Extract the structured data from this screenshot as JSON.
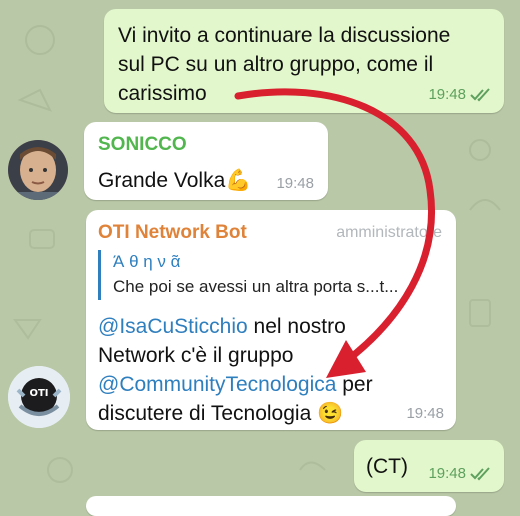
{
  "colors": {
    "background": "#b9c8a7",
    "outgoing_bubble": "#e2f7cb",
    "incoming_bubble": "#ffffff",
    "sonicco_name": "#52b64f",
    "bot_name": "#e0833a",
    "link": "#2f7fbf",
    "annotation_arrow": "#d8202f"
  },
  "messages": [
    {
      "direction": "out",
      "lines": [
        "Vi invito a continuare la discussione",
        "sul PC su un altro gruppo, come il",
        "carissimo"
      ],
      "time": "19:48",
      "status_icon": "double-check-icon"
    },
    {
      "direction": "in",
      "sender": "SONICCO",
      "text": "Grande Volka",
      "emoji": "💪",
      "time": "19:48",
      "avatar_icon": "user-avatar-photo"
    },
    {
      "direction": "in",
      "sender": "OTI Network Bot",
      "role": "amministratore",
      "reply": {
        "author": "Ά θ η ν ᾶ",
        "text": "Che poi se avessi un altra porta s...t..."
      },
      "mention1": "@IsaCuSticchio",
      "text1": " nel nostro",
      "line2": "Network c'è il gruppo",
      "mention2": "@CommunityTecnologica",
      "text3": " per",
      "line4": "discutere di Tecnologia",
      "emoji": "😉",
      "time": "19:48",
      "avatar_icon": "oti-bot-avatar"
    },
    {
      "direction": "out",
      "text": "(CT)",
      "time": "19:48",
      "status_icon": "double-check-icon"
    }
  ]
}
